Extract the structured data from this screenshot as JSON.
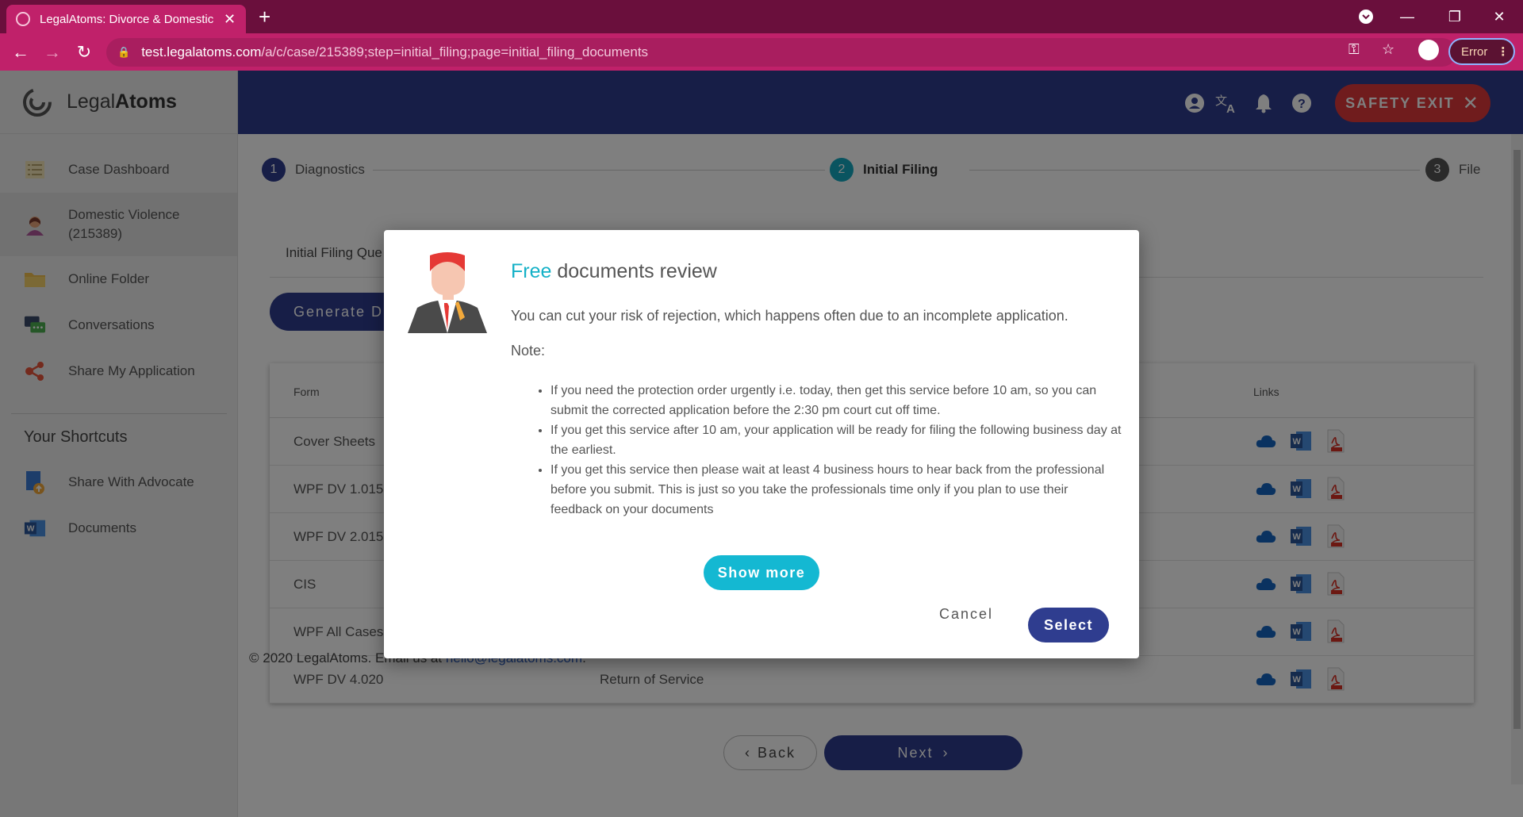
{
  "browser": {
    "tab_title": "LegalAtoms: Divorce & Domestic",
    "url_host": "test.legalatoms.com",
    "url_path": "/a/c/case/215389;step=initial_filing;page=initial_filing_documents",
    "error_label": "Error",
    "colors": {
      "tabbar": "#6a0f3c",
      "toolbar": "#c0216a"
    }
  },
  "brand": {
    "light": "Legal",
    "bold": "Atoms"
  },
  "sidebar": {
    "items": [
      {
        "label": "Case Dashboard",
        "icon": "list-icon"
      },
      {
        "label": "Domestic Violence (215389)",
        "icon": "person-avatar-icon"
      },
      {
        "label": "Online Folder",
        "icon": "folder-icon"
      },
      {
        "label": "Conversations",
        "icon": "chat-icon"
      },
      {
        "label": "Share My Application",
        "icon": "share-icon"
      }
    ],
    "shortcuts_title": "Your Shortcuts",
    "shortcuts": [
      {
        "label": "Share With Advocate",
        "icon": "share-file-icon"
      },
      {
        "label": "Documents",
        "icon": "word-icon"
      }
    ]
  },
  "header": {
    "safety_exit": "SAFETY EXIT",
    "color": "#2f3d8f"
  },
  "stepper": {
    "steps": [
      {
        "num": "1",
        "label": "Diagnostics"
      },
      {
        "num": "2",
        "label": "Initial Filing"
      },
      {
        "num": "3",
        "label": "File"
      }
    ]
  },
  "content": {
    "subtab": "Initial Filing Que",
    "generate_button": "Generate D",
    "table": {
      "headers": {
        "form": "Form",
        "links": "Links"
      },
      "rows": [
        {
          "form": "Cover Sheets",
          "desc": ""
        },
        {
          "form": "WPF DV 1.015",
          "desc": ""
        },
        {
          "form": "WPF DV 2.015",
          "desc": ""
        },
        {
          "form": "CIS",
          "desc": ""
        },
        {
          "form": "WPF All Cases",
          "desc": ""
        },
        {
          "form": "WPF DV 4.020",
          "desc": "Return of Service"
        }
      ]
    },
    "back_label": "Back",
    "next_label": "Next",
    "footer_text": "© 2020 LegalAtoms.  Email us at ",
    "footer_email": "hello@legalatoms.com",
    "footer_end": "."
  },
  "modal": {
    "title_highlight": "Free",
    "title_rest": " documents review",
    "lead": "You can cut your risk of rejection, which happens often due to an incomplete application.",
    "note_label": "Note:",
    "bullets": [
      "If you need the protection order urgently i.e. today, then get this service before 10 am, so you can submit the corrected application before the 2:30 pm court cut off time.",
      "If you get this service after 10 am, your application will be ready for filing the following business day at the earliest.",
      "If you get this service then please wait at least 4 business hours to hear back from the professional before you submit. This is just so you take the professionals time only if you plan to use their feedback on your documents"
    ],
    "show_more": "Show more",
    "cancel": "Cancel",
    "select": "Select",
    "accent_color": "#14b1c7"
  }
}
